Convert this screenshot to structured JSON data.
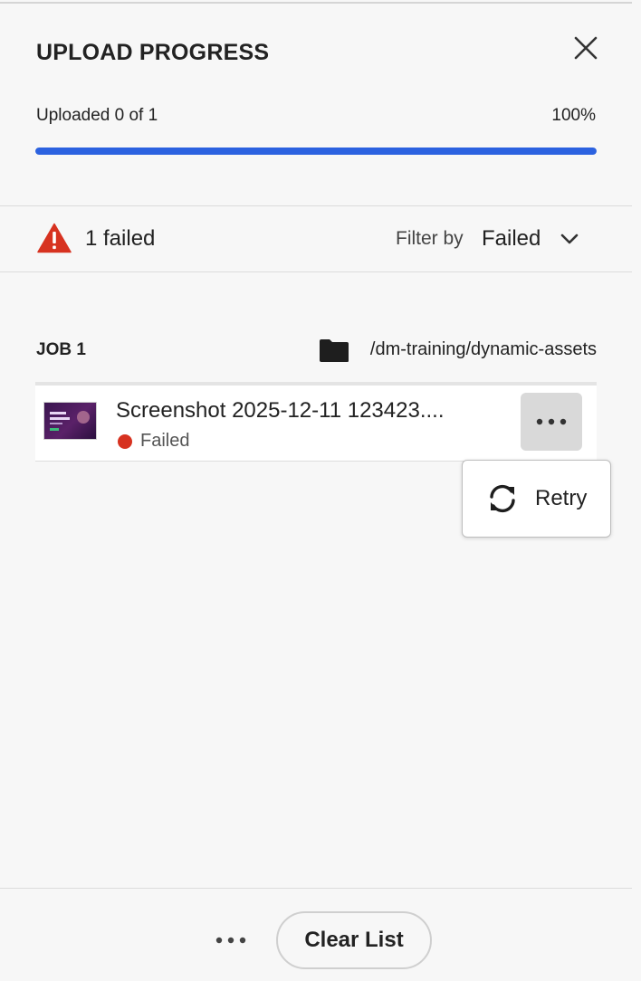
{
  "header": {
    "title": "UPLOAD PROGRESS",
    "close_icon": "close-icon"
  },
  "progress": {
    "label": "Uploaded 0 of 1",
    "percent_text": "100%",
    "fill_fraction": 1.0,
    "bar_color": "#2c62e0"
  },
  "summary": {
    "warning_icon": "alert-triangle-icon",
    "warning_color": "#d73220",
    "failed_text": "1 failed",
    "filter_label": "Filter by",
    "filter_value": "Failed",
    "filter_icon": "chevron-down-icon"
  },
  "job": {
    "label": "JOB 1",
    "folder_icon": "folder-icon",
    "path": "/dm-training/dynamic-assets",
    "files": [
      {
        "name": "Screenshot 2025-12-11 123423....",
        "status": "Failed",
        "status_color": "#d73220",
        "more_icon": "more-horizontal-icon"
      }
    ]
  },
  "context_menu": {
    "items": [
      {
        "label": "Retry",
        "icon": "refresh-icon"
      }
    ]
  },
  "footer": {
    "more_icon": "more-horizontal-icon",
    "clear_label": "Clear List"
  }
}
